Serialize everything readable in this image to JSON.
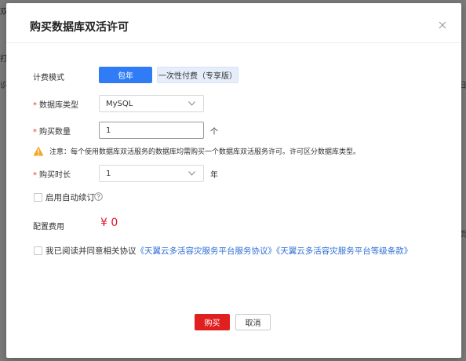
{
  "modal": {
    "title": "购买数据库双活许可",
    "billing": {
      "label": "计费模式",
      "option_year": "包年",
      "option_once": "一次性付费（专享版）"
    },
    "db_type": {
      "required_mark": "*",
      "label": "数据库类型",
      "value": "MySQL"
    },
    "quantity": {
      "required_mark": "*",
      "label": "购买数量",
      "value": "1",
      "unit": "个"
    },
    "notice": "注意：每个使用数据库双活服务的数据库均需购买一个数据库双活服务许可。许可区分数据库类型。",
    "duration": {
      "required_mark": "*",
      "label": "购买时长",
      "value": "1",
      "unit": "年"
    },
    "auto_renew_label": "启用自动续订",
    "fee": {
      "label": "配置费用",
      "value": "¥ 0"
    },
    "agreement": {
      "prefix": "我已阅读并同意相关协议",
      "link1": "《天翼云多活容灾服务平台服务协议》",
      "link2": "《天翼云多活容灾服务平台等级条款》"
    },
    "buttons": {
      "buy": "购买",
      "cancel": "取消"
    }
  },
  "colors": {
    "primary_blue": "#2f7cf6",
    "buy_red": "#e02020",
    "price_red": "#e0142c",
    "link_blue": "#2f6fd6"
  },
  "icons": [
    "close-icon",
    "chevron-down-icon",
    "warning-icon",
    "help-icon"
  ]
}
